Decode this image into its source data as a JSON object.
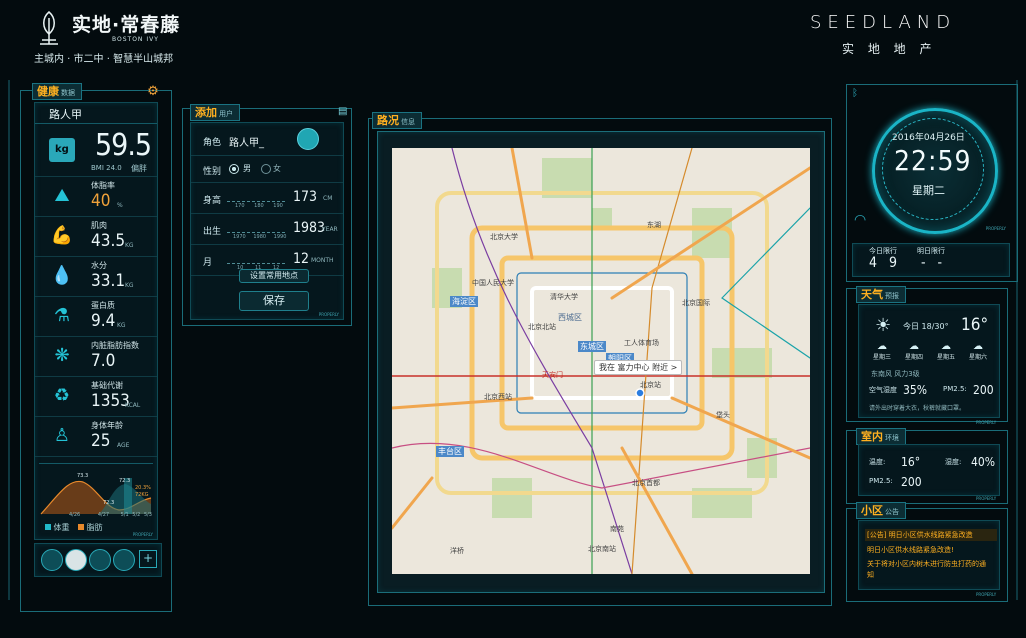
{
  "brand": {
    "logo_cn": "实地·常春藤",
    "logo_en": "BOSTON IVY",
    "slogan": "主城内 · 市二中 · 智慧半山城邦",
    "company_en": "SEEDLAND",
    "company_cn": "实 地 地 产"
  },
  "health": {
    "tag": "健康",
    "tag_sub": "数据",
    "user": "路人甲",
    "weight": "59.5",
    "weight_unit": "kg",
    "bmi": "BMI 24.0",
    "bmi_status": "偏胖",
    "metrics": [
      {
        "label": "体脂率",
        "value": "40",
        "unit": "%",
        "icon": "bodyfat-icon"
      },
      {
        "label": "肌肉",
        "value": "43.5",
        "unit": "KG",
        "icon": "muscle-icon"
      },
      {
        "label": "水分",
        "value": "33.1",
        "unit": "KG",
        "icon": "water-drop-icon"
      },
      {
        "label": "蛋白质",
        "value": "9.4",
        "unit": "KG",
        "icon": "protein-icon"
      },
      {
        "label": "内脏脂肪指数",
        "value": "7.0",
        "unit": "",
        "icon": "visceral-icon"
      },
      {
        "label": "基础代谢",
        "value": "1353",
        "unit": "KCAL",
        "icon": "recycle-icon"
      },
      {
        "label": "身体年龄",
        "value": "25",
        "unit": "AGE",
        "icon": "body-icon"
      }
    ],
    "chart": {
      "labels": [
        "73.3",
        "72.3",
        "20.3%",
        "72.3",
        "72KG"
      ],
      "ticks": [
        "4/26",
        "4/27",
        "5/1",
        "5/2",
        "5/3"
      ],
      "legend_weight": "体重",
      "legend_fat": "脂肪",
      "weight_color": "#21b9c9",
      "fat_color": "#e8892b"
    },
    "badge": "PROPERLY"
  },
  "add_user": {
    "tag": "添加",
    "tag_sub": "用户",
    "role_label": "角色",
    "role_value": "路人甲_",
    "gender_label": "性别",
    "gender_male": "男",
    "gender_female": "女",
    "height_label": "身高",
    "height_value": "173",
    "height_unit": "CM",
    "height_ticks": [
      "170",
      "180",
      "190"
    ],
    "birth_label": "出生",
    "birth_value": "1983",
    "birth_unit": "YEAR",
    "birth_ticks": [
      "1970",
      "1980",
      "1990"
    ],
    "month_label": "月",
    "month_value": "12",
    "month_unit": "MONTH",
    "month_ticks": [
      "10",
      "11",
      "12"
    ],
    "set_location": "设置常用地点",
    "save": "保存",
    "badge": "PROPERLY"
  },
  "traffic": {
    "tag": "路况",
    "tag_sub": "信息",
    "here": "我在 富力中心 附近 >",
    "places": [
      "北京大学",
      "中国人民大学",
      "清华大学",
      "北京北站",
      "海淀区",
      "西城区",
      "东城区",
      "朝阳区",
      "北京西站",
      "北京站",
      "丰台区",
      "北京南站",
      "工人体育场",
      "北京国际",
      "北京首都",
      "东湖",
      "南苑",
      "垡头",
      "洋桥",
      "天安门"
    ]
  },
  "clock": {
    "date": "2016年04月26日",
    "time": "22:59",
    "weekday": "星期二",
    "today_limit_label": "今日限行",
    "today_limit": "4 9",
    "tomorrow_limit_label": "明日限行",
    "tomorrow_limit": "- -",
    "badge": "PROPERLY"
  },
  "weather": {
    "tag": "天气",
    "tag_sub": "预报",
    "today": "今日 18/30°",
    "temp": "16°",
    "forecast": [
      "星期三",
      "星期四",
      "星期五",
      "星期六"
    ],
    "wind": "东南风 风力3级",
    "air_humidity_label": "空气湿度",
    "air_humidity": "35%",
    "pm25_label": "PM2.5:",
    "pm25": "200",
    "tip": "请外出时穿着大衣，秋裤就藏口罩。",
    "badge": "PROPERLY"
  },
  "indoor": {
    "tag": "室内",
    "tag_sub": "环境",
    "temp_label": "温度:",
    "temp": "16°",
    "humidity_label": "湿度:",
    "humidity": "40%",
    "pm25_label": "PM2.5:",
    "pm25": "200",
    "badge": "PROPERLY"
  },
  "notice": {
    "tag": "小区",
    "tag_sub": "公告",
    "items": [
      "[公告] 明日小区供水线路紧急改造",
      "明日小区供水线路紧急改造!",
      "关于将对小区内树木进行防虫打药的通知"
    ],
    "badge": "PROPERLY"
  }
}
